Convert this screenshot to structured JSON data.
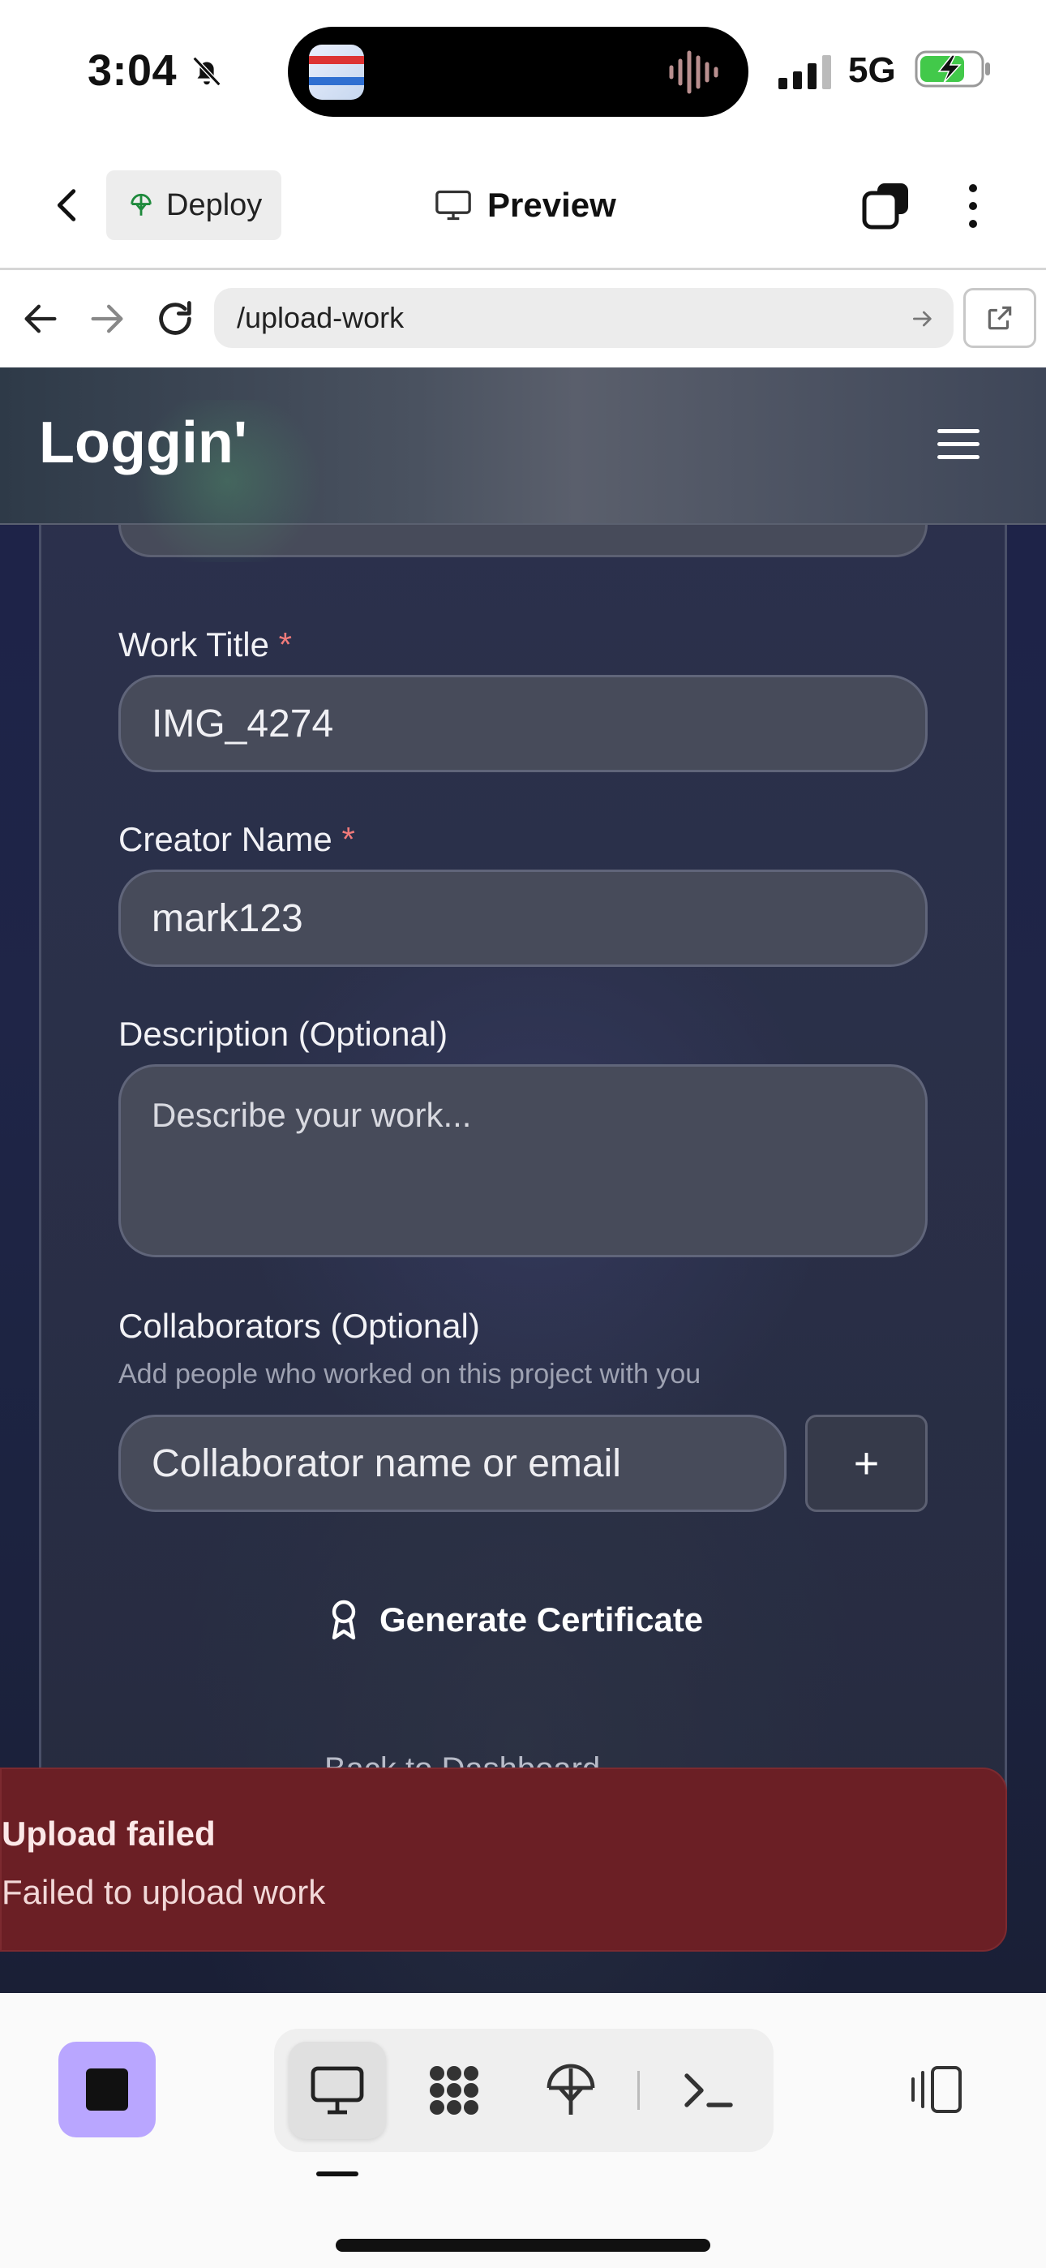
{
  "status_bar": {
    "time": "3:04",
    "network": "5G"
  },
  "app_bar": {
    "deploy_label": "Deploy",
    "preview_label": "Preview"
  },
  "url_bar": {
    "url": "/upload-work"
  },
  "site": {
    "brand": "Loggin'",
    "form": {
      "work_title_label": "Work Title",
      "work_title_value": "IMG_4274",
      "creator_label": "Creator Name",
      "creator_value": "mark123",
      "required_mark": "*",
      "description_label": "Description (Optional)",
      "description_placeholder": "Describe your work...",
      "collaborators_label": "Collaborators (Optional)",
      "collaborators_hint": "Add people who worked on this project with you",
      "collaborator_placeholder": "Collaborator name or email",
      "add_button": "+",
      "generate_label": "Generate Certificate",
      "back_label": "Back to Dashboard"
    }
  },
  "toast": {
    "title": "Upload failed",
    "message": "Failed to upload work"
  },
  "colors": {
    "toast_bg": "#6b1f25",
    "stop_button": "#b9a6ff",
    "required": "#f07a7a"
  }
}
